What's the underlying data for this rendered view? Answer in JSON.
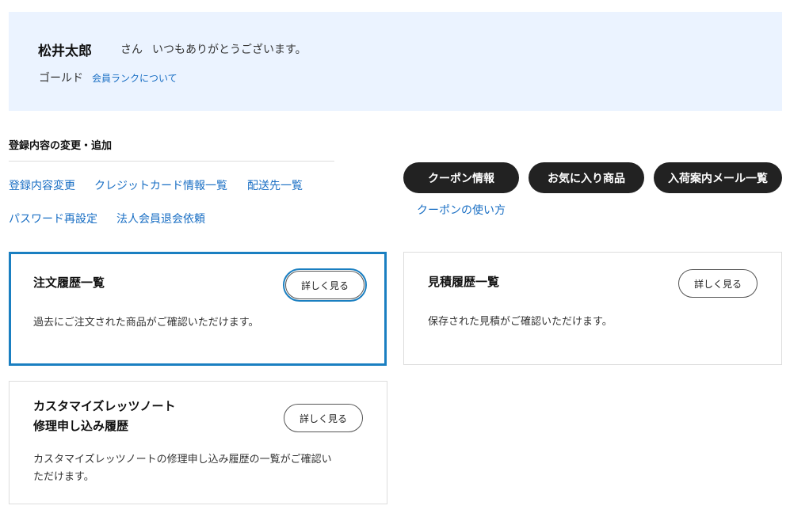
{
  "greeting": {
    "user_name": "松井太郎",
    "honorific": "さん",
    "thanks": "いつもありがとうございます。",
    "rank": "ゴールド",
    "rank_link": "会員ランクについて"
  },
  "registration": {
    "title": "登録内容の変更・追加",
    "links": [
      "登録内容変更",
      "クレジットカード情報一覧",
      "配送先一覧",
      "パスワード再設定",
      "法人会員退会依頼"
    ]
  },
  "pills": [
    "クーポン情報",
    "お気に入り商品",
    "入荷案内メール一覧"
  ],
  "coupon_how": "クーポンの使い方",
  "cards": [
    {
      "title": "注文履歴一覧",
      "desc": "過去にご注文された商品がご確認いただけます。",
      "button": "詳しく見る"
    },
    {
      "title": "見積履歴一覧",
      "desc": "保存された見積がご確認いただけます。",
      "button": "詳しく見る"
    },
    {
      "title_line1": "カスタマイズレッツノート",
      "title_line2": "修理申し込み履歴",
      "desc_line1": "カスタマイズレッツノートの修理申し込み履歴の一覧がご確認い",
      "desc_line2": "ただけます。",
      "button": "詳しく見る"
    }
  ]
}
